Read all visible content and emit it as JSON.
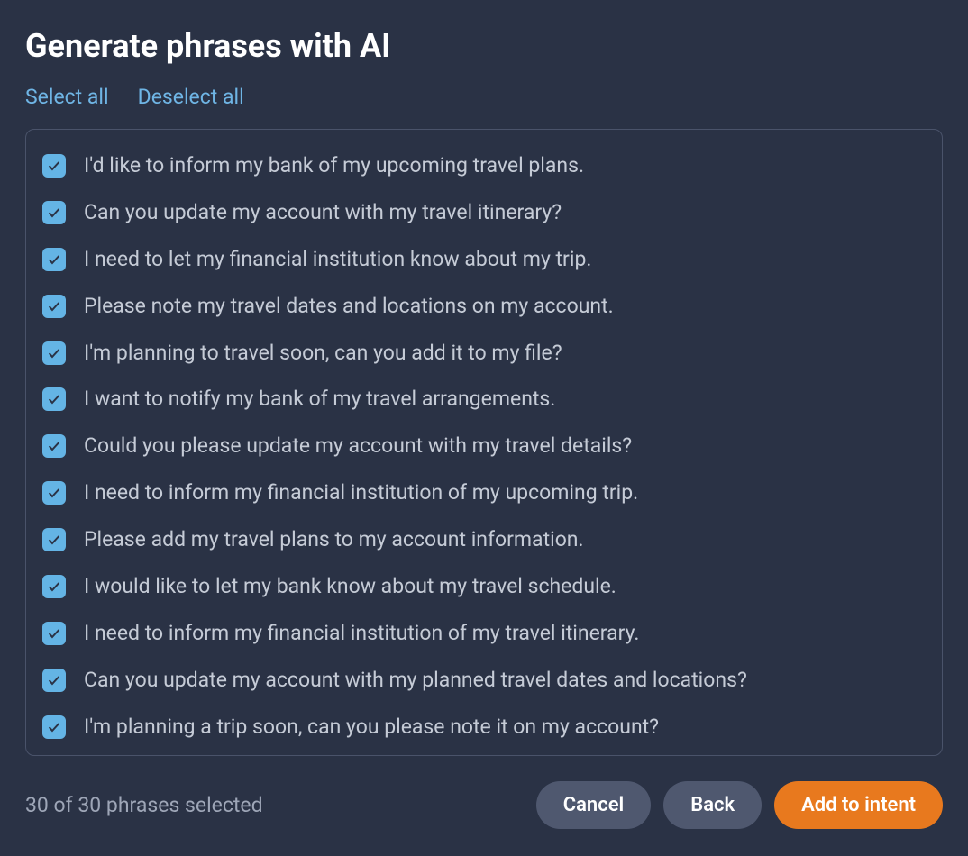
{
  "title": "Generate phrases with AI",
  "links": {
    "select_all": "Select all",
    "deselect_all": "Deselect all"
  },
  "phrases": [
    {
      "checked": true,
      "text": "I'd like to inform my bank of my upcoming travel plans."
    },
    {
      "checked": true,
      "text": "Can you update my account with my travel itinerary?"
    },
    {
      "checked": true,
      "text": "I need to let my financial institution know about my trip."
    },
    {
      "checked": true,
      "text": "Please note my travel dates and locations on my account."
    },
    {
      "checked": true,
      "text": "I'm planning to travel soon, can you add it to my file?"
    },
    {
      "checked": true,
      "text": "I want to notify my bank of my travel arrangements."
    },
    {
      "checked": true,
      "text": "Could you please update my account with my travel details?"
    },
    {
      "checked": true,
      "text": "I need to inform my financial institution of my upcoming trip."
    },
    {
      "checked": true,
      "text": "Please add my travel plans to my account information."
    },
    {
      "checked": true,
      "text": "I would like to let my bank know about my travel schedule."
    },
    {
      "checked": true,
      "text": "I need to inform my financial institution of my travel itinerary."
    },
    {
      "checked": true,
      "text": "Can you update my account with my planned travel dates and locations?"
    },
    {
      "checked": true,
      "text": "I'm planning a trip soon, can you please note it on my account?"
    }
  ],
  "footer": {
    "selected_count": "30 of 30 phrases selected",
    "cancel": "Cancel",
    "back": "Back",
    "add_to_intent": "Add to intent"
  }
}
